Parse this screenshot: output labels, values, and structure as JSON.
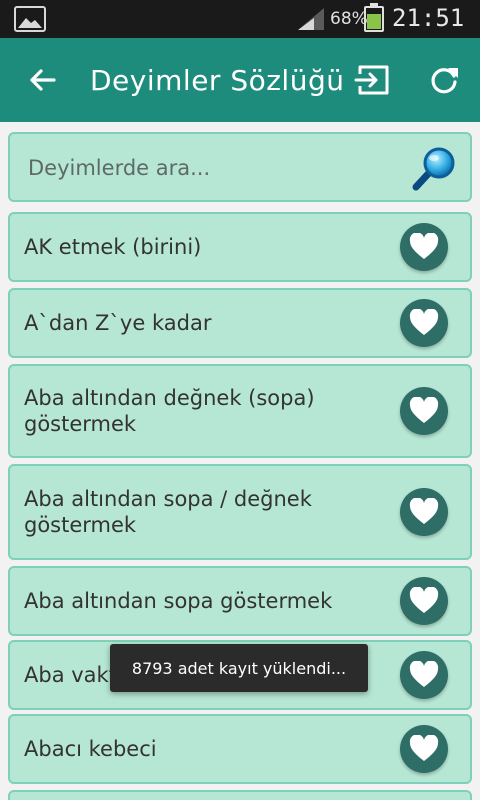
{
  "status_bar": {
    "battery": "68%",
    "battery_level": 0.68,
    "time": "21:51",
    "icons": [
      "image-notification-icon",
      "signal-icon",
      "battery-icon"
    ]
  },
  "app_bar": {
    "title": "Deyimler Sözlüğü",
    "icons": [
      "back-arrow-icon",
      "exit-icon",
      "refresh-icon"
    ],
    "color": "#1e8c7c"
  },
  "search": {
    "placeholder": "Deyimlerde ara...",
    "value": "",
    "icon": "magnifier-icon"
  },
  "items": [
    {
      "label": "AK etmek (birini)"
    },
    {
      "label": "A`dan Z`ye kadar"
    },
    {
      "label": "Aba altından değnek (sopa) göstermek"
    },
    {
      "label": "Aba altından sopa / değnek göstermek"
    },
    {
      "label": "Aba altından sopa göstermek"
    },
    {
      "label": "Aba vakti"
    },
    {
      "label": "Abacı kebeci"
    }
  ],
  "toast": {
    "text": "8793 adet kayıt yüklendi..."
  },
  "colors": {
    "accent": "#1e8c7c",
    "item_bg": "#b6e6d4",
    "item_border": "#7fd0b8",
    "fav_button": "#2e6e66"
  }
}
